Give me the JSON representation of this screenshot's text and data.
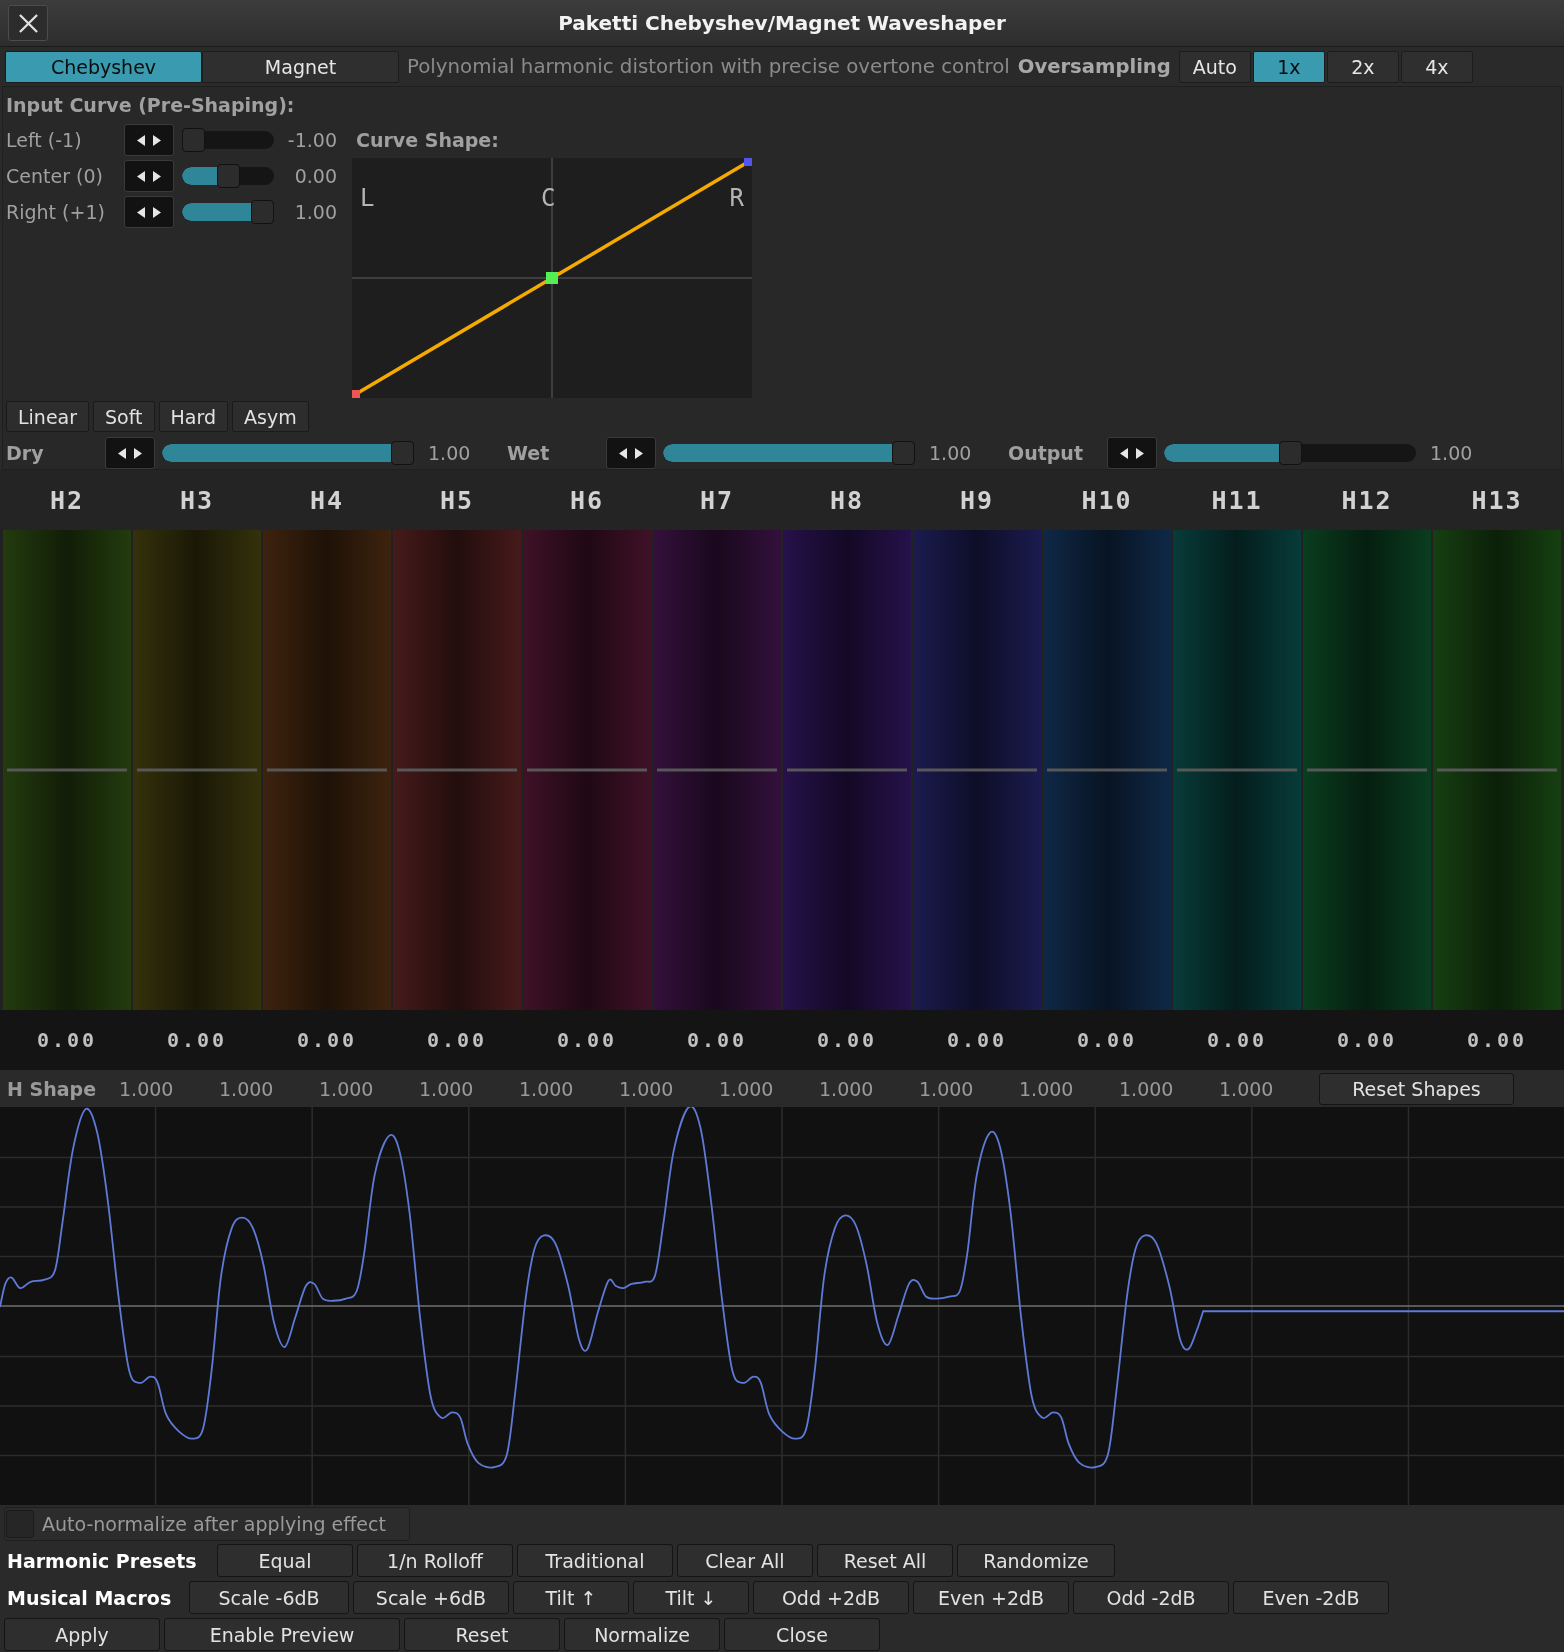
{
  "window": {
    "title": "Paketti Chebyshev/Magnet Waveshaper"
  },
  "mode_tabs": [
    {
      "label": "Chebyshev",
      "selected": true
    },
    {
      "label": "Magnet",
      "selected": false
    }
  ],
  "description": "Polynomial harmonic distortion with precise overtone control",
  "oversampling": {
    "label": "Oversampling",
    "options": [
      {
        "label": "Auto",
        "selected": false
      },
      {
        "label": "1x",
        "selected": true
      },
      {
        "label": "2x",
        "selected": false
      },
      {
        "label": "4x",
        "selected": false
      }
    ]
  },
  "input_curve": {
    "title": "Input Curve (Pre-Shaping):",
    "sliders": [
      {
        "label": "Left (-1)",
        "level": 0,
        "reading": "-1.00",
        "color": "#ee5555"
      },
      {
        "label": "Center (0)",
        "level": 0.5,
        "reading": "0.00",
        "color": "#55ee55"
      },
      {
        "label": "Right (+1)",
        "level": 1,
        "reading": "1.00",
        "color": "#5555ee"
      }
    ],
    "curve_title": "Curve Shape:",
    "curve_markers": [
      "L",
      "C",
      "R"
    ],
    "presets": [
      "Linear",
      "Soft",
      "Hard",
      "Asym"
    ]
  },
  "mix": [
    {
      "label": "Dry",
      "level": 1,
      "reading": "1.00"
    },
    {
      "label": "Wet",
      "level": 1,
      "reading": "1.00"
    },
    {
      "label": "Output",
      "level": 0.5,
      "reading": "1.00"
    }
  ],
  "harmonics": [
    {
      "label": "H2",
      "color": "#233b0e",
      "level": 0.5,
      "reading": "0.00"
    },
    {
      "label": "H3",
      "color": "#34310b",
      "level": 0.5,
      "reading": "0.00"
    },
    {
      "label": "H4",
      "color": "#3d230e",
      "level": 0.5,
      "reading": "0.00"
    },
    {
      "label": "H5",
      "color": "#461a1a",
      "level": 0.5,
      "reading": "0.00"
    },
    {
      "label": "H6",
      "color": "#3f1127",
      "level": 0.5,
      "reading": "0.00"
    },
    {
      "label": "H7",
      "color": "#33103b",
      "level": 0.5,
      "reading": "0.00"
    },
    {
      "label": "H8",
      "color": "#26114a",
      "level": 0.5,
      "reading": "0.00"
    },
    {
      "label": "H9",
      "color": "#1b1b4f",
      "level": 0.5,
      "reading": "0.00"
    },
    {
      "label": "H10",
      "color": "#0f2846",
      "level": 0.5,
      "reading": "0.00"
    },
    {
      "label": "H11",
      "color": "#073b39",
      "level": 0.5,
      "reading": "0.00"
    },
    {
      "label": "H12",
      "color": "#0a3d1f",
      "level": 0.5,
      "reading": "0.00"
    },
    {
      "label": "H13",
      "color": "#163f11",
      "level": 0.5,
      "reading": "0.00"
    }
  ],
  "h_shape": {
    "label": "H Shape",
    "values": [
      "1.000",
      "1.000",
      "1.000",
      "1.000",
      "1.000",
      "1.000",
      "1.000",
      "1.000",
      "1.000",
      "1.000",
      "1.000",
      "1.000"
    ],
    "reset_button": "Reset Shapes"
  },
  "auto_normalize": {
    "label": "Auto-normalize after applying effect",
    "checked": false
  },
  "harmonic_presets": {
    "label": "Harmonic Presets",
    "buttons": [
      "Equal",
      "1/n Rolloff",
      "Traditional",
      "Clear All",
      "Reset All",
      "Randomize"
    ]
  },
  "musical_macros": {
    "label": "Musical Macros",
    "buttons": [
      "Scale -6dB",
      "Scale +6dB",
      "Tilt ↑",
      "Tilt ↓",
      "Odd +2dB",
      "Even +2dB",
      "Odd -2dB",
      "Even -2dB"
    ]
  },
  "actions": [
    "Apply",
    "Enable Preview",
    "Reset",
    "Normalize",
    "Close"
  ]
}
